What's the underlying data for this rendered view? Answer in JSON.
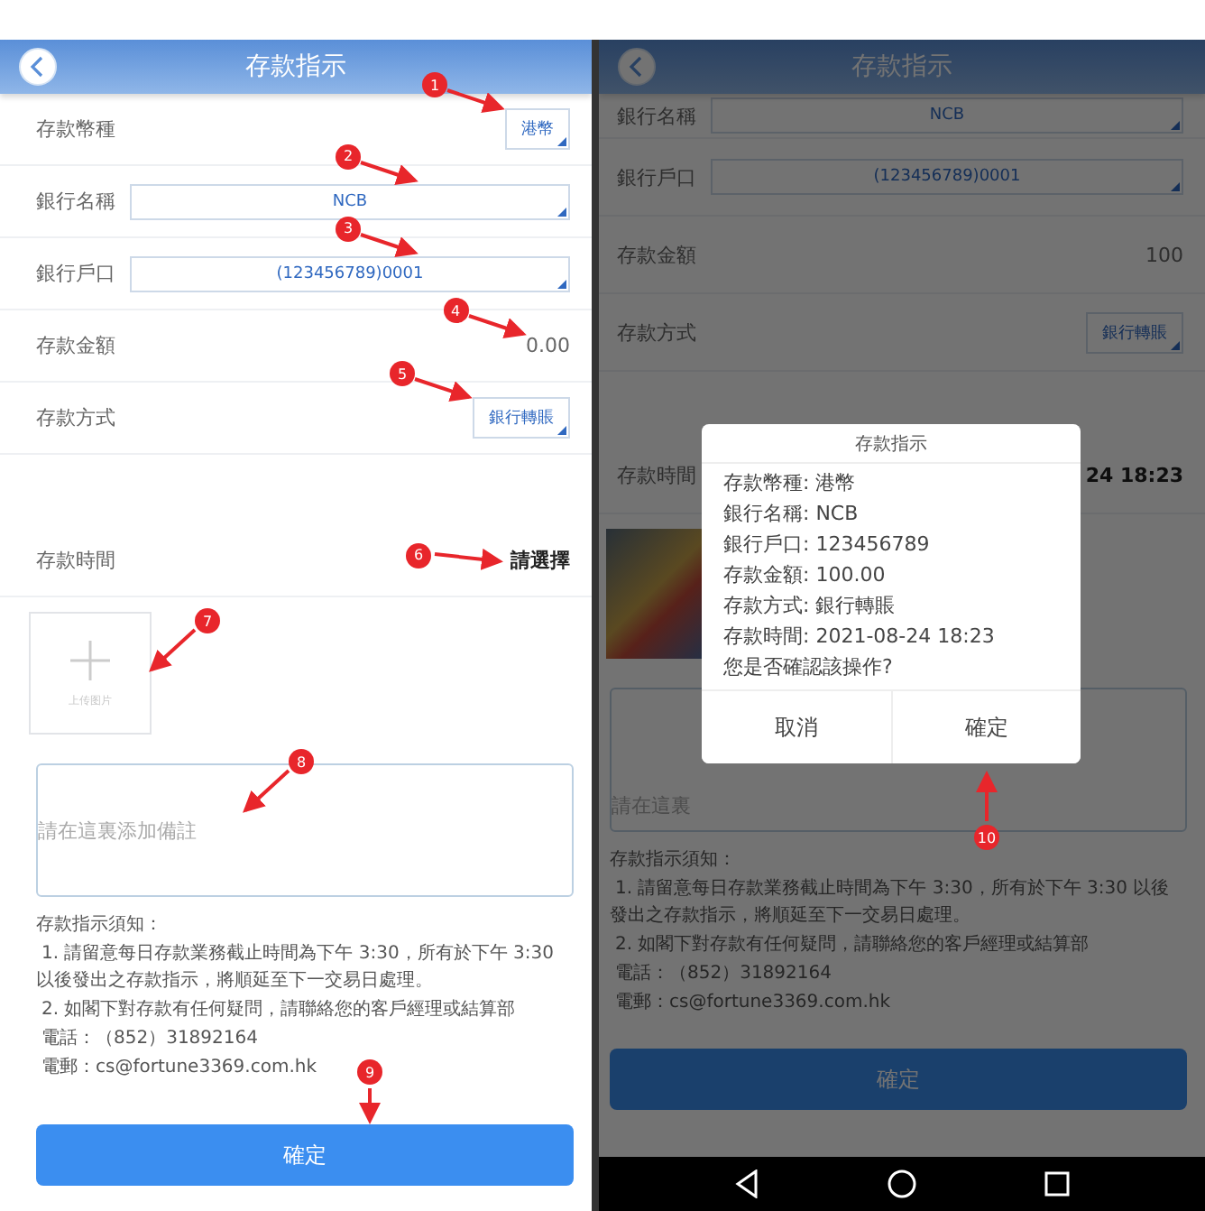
{
  "left_screen": {
    "header": {
      "title": "存款指示"
    },
    "fields": [
      {
        "kind": "select",
        "label": "存款幣種",
        "value": "港幣",
        "marker": "1"
      },
      {
        "kind": "wide_select",
        "label": "銀行名稱",
        "value": "NCB",
        "marker": "2"
      },
      {
        "kind": "wide_select",
        "label": "銀行戶口",
        "value": "(123456789)0001",
        "marker": "3"
      },
      {
        "kind": "text",
        "label": "存款金額",
        "value": "0.00",
        "marker": "4"
      },
      {
        "kind": "select",
        "label": "存款方式",
        "value": "銀行轉賬",
        "marker": "5"
      },
      {
        "kind": "picker",
        "label": "存款時間",
        "value": "請選擇",
        "marker": "6"
      }
    ],
    "upload": {
      "label": "上传图片",
      "marker": "7"
    },
    "remark": {
      "placeholder": "請在這裏添加備註",
      "marker": "8"
    },
    "notice": {
      "title": "存款指示須知：",
      "lines": [
        "1. 請留意每日存款業務截止時間為下午 3:30，所有於下午 3:30 以後發出之存款指示，將順延至下一交易日處理。",
        "2. 如閣下對存款有任何疑問，請聯絡您的客戶經理或結算部",
        "電話：（852）31892164",
        "電郵：cs@fortune3369.com.hk"
      ]
    },
    "submit": {
      "label": "確定",
      "marker": "9"
    }
  },
  "right_screen": {
    "header": {
      "title": "存款指示"
    },
    "fields": [
      {
        "kind": "wide_select",
        "label": "銀行名稱",
        "value": "NCB"
      },
      {
        "kind": "wide_select",
        "label": "銀行戶口",
        "value": "(123456789)0001"
      },
      {
        "kind": "text",
        "label": "存款金額",
        "value": "100"
      },
      {
        "kind": "select",
        "label": "存款方式",
        "value": "銀行轉賬"
      },
      {
        "kind": "picker",
        "label": "存款時間",
        "value": "24 18:23"
      }
    ],
    "remark": {
      "placeholder": "請在這裏"
    },
    "notice": {
      "title": "存款指示須知：",
      "lines": [
        "1. 請留意每日存款業務截止時間為下午 3:30，所有於下午 3:30 以後發出之存款指示，將順延至下一交易日處理。",
        "2. 如閣下對存款有任何疑問，請聯絡您的客戶經理或結算部",
        "電話：（852）31892164",
        "電郵：cs@fortune3369.com.hk"
      ]
    },
    "submit": {
      "label": "確定"
    },
    "dialog": {
      "title": "存款指示",
      "lines": [
        "存款幣種: 港幣",
        "銀行名稱: NCB",
        "銀行戶口: 123456789",
        "存款金額: 100.00",
        "存款方式: 銀行轉賬",
        "存款時間: 2021-08-24 18:23",
        "您是否確認該操作?"
      ],
      "cancel": "取消",
      "confirm": "確定",
      "marker": "10"
    }
  }
}
